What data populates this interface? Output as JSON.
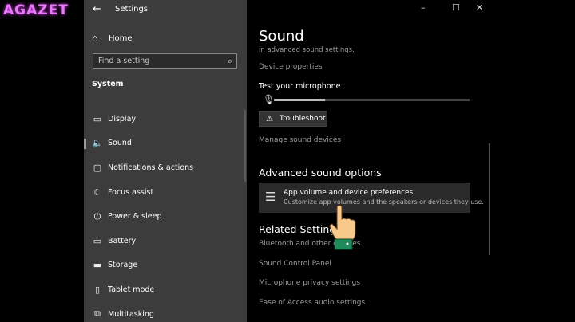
{
  "watermark": "AGAZET",
  "window": {
    "title": "Settings",
    "controls": {
      "minimize": "–",
      "maximize": "☐",
      "close": "✕"
    }
  },
  "sidebar": {
    "home_label": "Home",
    "search_placeholder": "Find a setting",
    "section_label": "System",
    "items": [
      {
        "label": "Display",
        "icon": "display-icon",
        "glyph": "▭"
      },
      {
        "label": "Sound",
        "icon": "speaker-icon",
        "glyph": "🔈",
        "active": true
      },
      {
        "label": "Notifications & actions",
        "icon": "notification-icon",
        "glyph": "▢"
      },
      {
        "label": "Focus assist",
        "icon": "moon-icon",
        "glyph": "☾"
      },
      {
        "label": "Power & sleep",
        "icon": "power-icon",
        "glyph": "⏻"
      },
      {
        "label": "Battery",
        "icon": "battery-icon",
        "glyph": "▭"
      },
      {
        "label": "Storage",
        "icon": "storage-icon",
        "glyph": "▬"
      },
      {
        "label": "Tablet mode",
        "icon": "tablet-icon",
        "glyph": "▯"
      },
      {
        "label": "Multitasking",
        "icon": "multitasking-icon",
        "glyph": "⧉"
      }
    ]
  },
  "main": {
    "title": "Sound",
    "faded_text": "in advanced sound settings.",
    "device_properties": "Device properties",
    "test_mic_label": "Test your microphone",
    "mic_level": 0.26,
    "troubleshoot_label": "Troubleshoot",
    "manage_devices": "Manage sound devices",
    "advanced_heading": "Advanced sound options",
    "app_volume_title": "App volume and device preferences",
    "app_volume_desc": "Customize app volumes and the speakers or devices they use.",
    "related_heading": "Related Settings",
    "related_links": [
      "Bluetooth and other devices",
      "Sound Control Panel",
      "Microphone privacy settings",
      "Ease of Access audio settings"
    ]
  }
}
